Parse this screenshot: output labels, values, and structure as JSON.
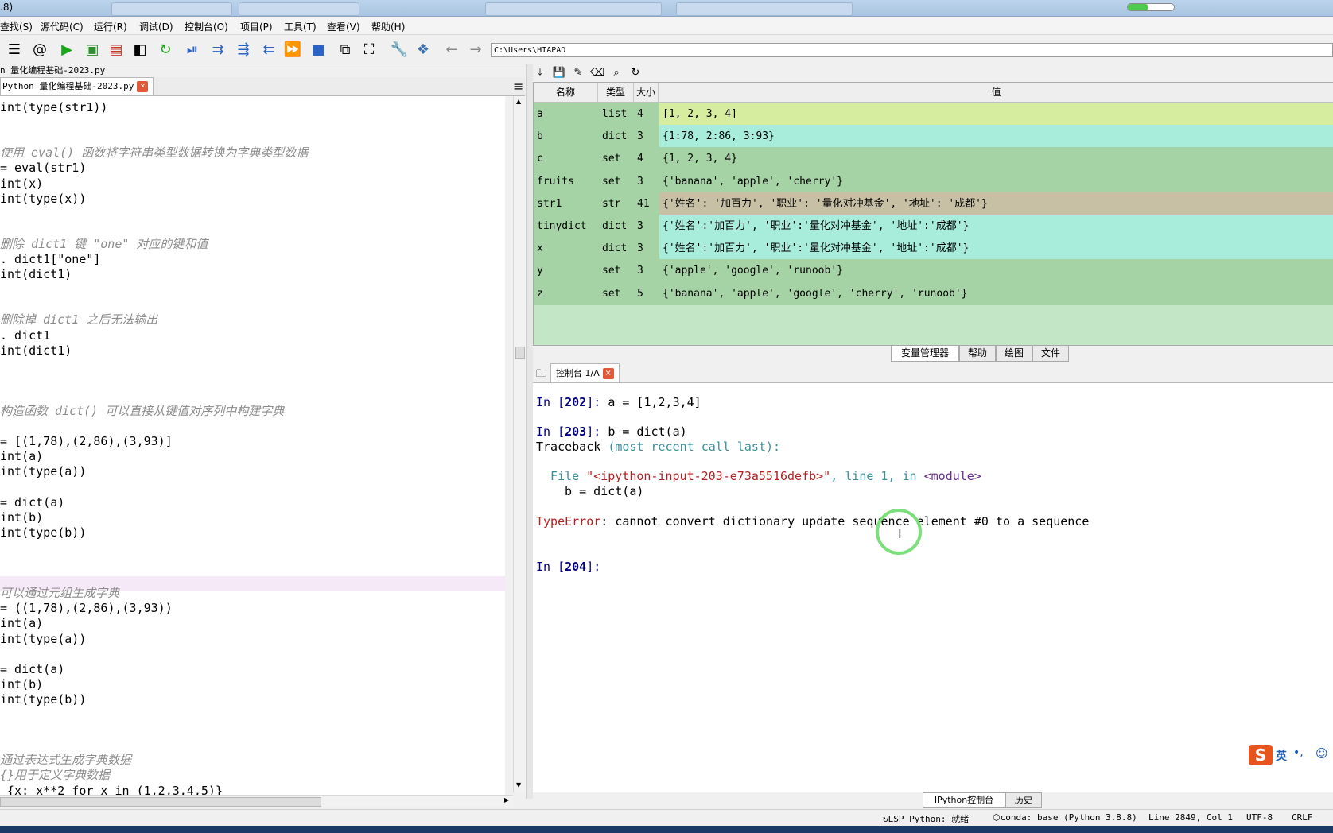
{
  "window": {
    "title_fragment": ".8)"
  },
  "menu": [
    "查找(S)",
    "源代码(C)",
    "运行(R)",
    "调试(D)",
    "控制台(O)",
    "项目(P)",
    "工具(T)",
    "查看(V)",
    "帮助(H)"
  ],
  "toolbar": {
    "path": "C:\\Users\\HIAPAD"
  },
  "progress": {
    "fraction": 0.45
  },
  "editor": {
    "window_title": "n 量化编程基础-2023.py",
    "tab_label": "Python 量化编程基础-2023.py",
    "tab_close": "×",
    "code_lines": [
      "int(type(str1))",
      "",
      "",
      "使用 eval() 函数将字符串类型数据转换为字典类型数据",
      "= eval(str1)",
      "int(x)",
      "int(type(x))",
      "",
      "",
      "删除 dict1 键 \"one\" 对应的键和值",
      ". dict1[\"one\"]",
      "int(dict1)",
      "",
      "",
      "删除掉 dict1 之后无法输出",
      ". dict1",
      "int(dict1)",
      "",
      "",
      "",
      "构造函数 dict() 可以直接从键值对序列中构建字典",
      "",
      "= [(1,78),(2,86),(3,93)]",
      "int(a)",
      "int(type(a))",
      "",
      "= dict(a)",
      "int(b)",
      "int(type(b))",
      "",
      "",
      "",
      "可以通过元组生成字典",
      "= ((1,78),(2,86),(3,93))",
      "int(a)",
      "int(type(a))",
      "",
      "= dict(a)",
      "int(b)",
      "int(type(b))",
      "",
      "",
      "",
      "通过表达式生成字典数据",
      "{}用于定义字典数据",
      " {x: x**2 for x in (1,2,3,4,5)}"
    ]
  },
  "variable_explorer": {
    "columns": [
      "名称",
      "类型",
      "大小",
      "值"
    ],
    "rows": [
      {
        "name": "a",
        "type": "list",
        "size": "4",
        "value": "[1, 2, 3, 4]",
        "color": "#d6ec9f"
      },
      {
        "name": "b",
        "type": "dict",
        "size": "3",
        "value": "{1:78, 2:86, 3:93}",
        "color": "#a8eddb"
      },
      {
        "name": "c",
        "type": "set",
        "size": "4",
        "value": "{1, 2, 3, 4}",
        "color": "#a5d3a5"
      },
      {
        "name": "fruits",
        "type": "set",
        "size": "3",
        "value": "{'banana', 'apple', 'cherry'}",
        "color": "#a5d3a5"
      },
      {
        "name": "str1",
        "type": "str",
        "size": "41",
        "value": "{'姓名': '加百力', '职业': '量化对冲基金', '地址': '成都'}",
        "color": "#c7c0a5"
      },
      {
        "name": "tinydict",
        "type": "dict",
        "size": "3",
        "value": "{'姓名':'加百力', '职业':'量化对冲基金', '地址':'成都'}",
        "color": "#a8eddb"
      },
      {
        "name": "x",
        "type": "dict",
        "size": "3",
        "value": "{'姓名':'加百力', '职业':'量化对冲基金', '地址':'成都'}",
        "color": "#a8eddb"
      },
      {
        "name": "y",
        "type": "set",
        "size": "3",
        "value": "{'apple', 'google', 'runoob'}",
        "color": "#a5d3a5"
      },
      {
        "name": "z",
        "type": "set",
        "size": "5",
        "value": "{'banana', 'apple', 'google', 'cherry', 'runoob'}",
        "color": "#a5d3a5"
      }
    ],
    "pane_tabs": [
      "变量管理器",
      "帮助",
      "绘图",
      "文件"
    ]
  },
  "console": {
    "tab_label": "控制台 1/A",
    "tab_close": "×",
    "in202_prefix": "In [",
    "in202_num": "202",
    "in202_suffix": "]: ",
    "in202_code": "a = [1,2,3,4]",
    "in203_prefix": "In [",
    "in203_num": "203",
    "in203_suffix": "]: ",
    "in203_code": "b = dict(a)",
    "traceback_head": "Traceback ",
    "traceback_note": "(most recent call last):",
    "file_kw": "File ",
    "file_name": "\"<ipython-input-203-e73a5516defb>\"",
    "file_line": ", line ",
    "file_line_num": "1",
    "file_in": ", in ",
    "file_module": "<module>",
    "code_echo": "  b = dict(a)",
    "error_type": "TypeError",
    "error_msg": ": cannot convert dictionary update sequence element #0 to a sequence",
    "in204_prefix": "In [",
    "in204_num": "204",
    "in204_suffix": "]: ",
    "bottom_tabs": [
      "IPython控制台",
      "历史"
    ]
  },
  "ime": {
    "label": "英"
  },
  "statusbar": {
    "lsp": "LSP Python: 就绪",
    "conda": "conda: base (Python 3.8.8)",
    "position": "Line 2849, Col 1",
    "encoding": "UTF-8",
    "eol": "CRLF"
  }
}
